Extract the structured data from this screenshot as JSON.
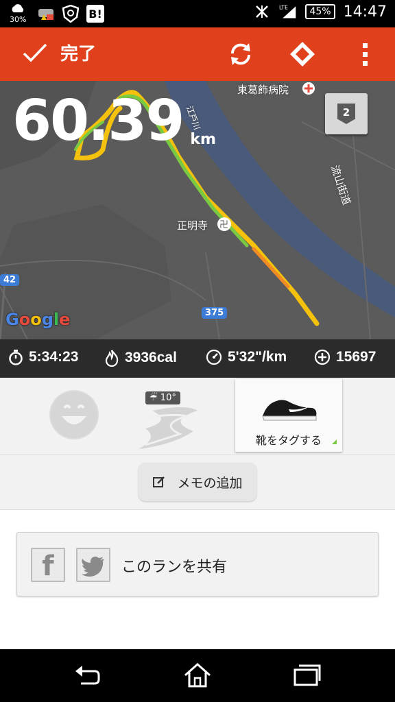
{
  "status_bar": {
    "weather_percent": "30%",
    "battery": "45%",
    "network": "LTE",
    "time": "14:47",
    "b_app": "B!"
  },
  "action_bar": {
    "done_label": "完了",
    "color": "#e0401c"
  },
  "map": {
    "distance_value": "60.39",
    "distance_unit": "km",
    "labels": {
      "hospital": "東葛飾病院",
      "temple": "正明寺",
      "road_right": "流山街道",
      "river": "江戸川"
    },
    "road_42": "42",
    "road_375": "375",
    "google_letters": [
      "G",
      "o",
      "o",
      "g",
      "l",
      "e"
    ],
    "lap_count": "2"
  },
  "stats": {
    "duration": "5:34:23",
    "calories": "3936cal",
    "pace": "5'32\"/km",
    "fuel": "15697"
  },
  "details": {
    "weather_temp": "10°",
    "shoe_tag_label": "靴をタグする",
    "memo_label": "メモの追加",
    "share_label": "このランを共有"
  }
}
